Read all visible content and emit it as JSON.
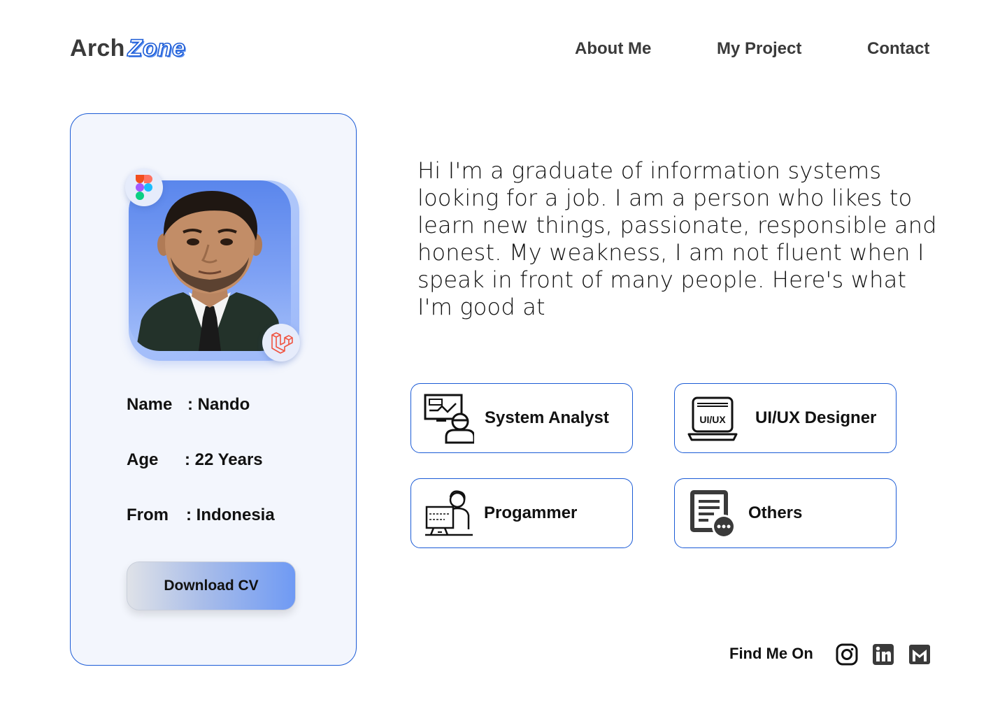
{
  "header": {
    "logo_part1": "Arch",
    "logo_part2": "Zone",
    "nav": {
      "about": "About Me",
      "project": "My Project",
      "contact": "Contact"
    }
  },
  "profile": {
    "name_label": "Name",
    "name_value": ": Nando",
    "age_label": "Age",
    "age_value": ": 22 Years",
    "from_label": "From",
    "from_value": ": Indonesia",
    "download_label": "Download CV",
    "badges": [
      "figma-icon",
      "laravel-icon"
    ]
  },
  "about": {
    "text": "Hi I'm a graduate of information systems looking for a job. I am a person who likes to learn new things, passionate, responsible and honest. My weakness, I am not fluent when I speak in front of many people. Here's what I'm good at"
  },
  "skills": [
    {
      "label": "System Analyst",
      "icon": "system-analyst-icon"
    },
    {
      "label": "UI/UX Designer",
      "icon": "uiux-laptop-icon"
    },
    {
      "label": "Progammer",
      "icon": "programmer-icon"
    },
    {
      "label": "Others",
      "icon": "document-more-icon"
    }
  ],
  "uiux_icon_text": "UI/UX",
  "social": {
    "label": "Find Me On",
    "icons": [
      "instagram-icon",
      "linkedin-icon",
      "gmail-icon"
    ]
  },
  "colors": {
    "accent": "#1b5bd6",
    "card_bg": "#f3f6fd",
    "photo_bg": "#7ea1f4"
  }
}
